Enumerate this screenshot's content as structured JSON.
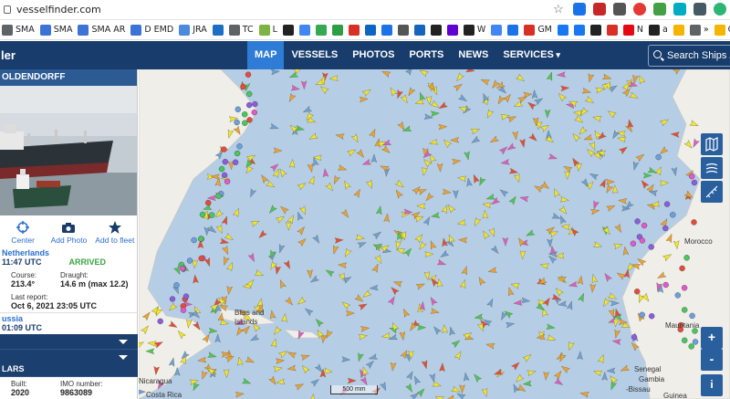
{
  "browser": {
    "url": "vesselfinder.com",
    "bookmarks": [
      {
        "label": "SMA",
        "icon": "globe-icon",
        "color": "#5f6368"
      },
      {
        "label": "SMA",
        "icon": "bookmark-site-icon",
        "color": "#3b73d6"
      },
      {
        "label": "SMA AR",
        "icon": "bookmark-site-icon",
        "color": "#3b73d6"
      },
      {
        "label": "D EMD",
        "icon": "bookmark-site-icon",
        "color": "#3b73d6"
      },
      {
        "label": "JRA",
        "icon": "diamond-icon",
        "color": "#4a8bdb"
      },
      {
        "label": "",
        "icon": "outlook-icon",
        "color": "#1d6fc4"
      },
      {
        "label": "TC",
        "icon": "globe-icon",
        "color": "#5f6368"
      },
      {
        "label": "L",
        "icon": "bookmark-site-icon",
        "color": "#7cb342"
      },
      {
        "label": "",
        "icon": "bookmark-site-icon",
        "color": "#222222"
      },
      {
        "label": "",
        "icon": "google-icon",
        "color": "#4285f4"
      },
      {
        "label": "",
        "icon": "maps-icon",
        "color": "#34a853"
      },
      {
        "label": "",
        "icon": "bookmark-site-icon",
        "color": "#2e9e44"
      },
      {
        "label": "",
        "icon": "bookmark-site-icon",
        "color": "#d93025"
      },
      {
        "label": "",
        "icon": "linkedin-icon",
        "color": "#0a66c2"
      },
      {
        "label": "",
        "icon": "bookmark-site-icon",
        "color": "#1a73e8"
      },
      {
        "label": "",
        "icon": "bookmark-site-icon",
        "color": "#555555"
      },
      {
        "label": "",
        "icon": "bookmark-site-icon",
        "color": "#1565c0"
      },
      {
        "label": "",
        "icon": "bookmark-site-icon",
        "color": "#222222"
      },
      {
        "label": "",
        "icon": "yahoo-icon",
        "color": "#6001d2"
      },
      {
        "label": "W",
        "icon": "wikipedia-icon",
        "color": "#222222"
      },
      {
        "label": "",
        "icon": "bookmark-site-icon",
        "color": "#4285f4"
      },
      {
        "label": "",
        "icon": "bookmark-site-icon",
        "color": "#1a73e8"
      },
      {
        "label": "GM",
        "icon": "bookmark-site-icon",
        "color": "#d93025"
      },
      {
        "label": "",
        "icon": "facebook-icon",
        "color": "#1877f2"
      },
      {
        "label": "",
        "icon": "facebook-icon",
        "color": "#1877f2"
      },
      {
        "label": "",
        "icon": "bookmark-site-icon",
        "color": "#222222"
      },
      {
        "label": "",
        "icon": "bookmark-site-icon",
        "color": "#d93025"
      },
      {
        "label": "N",
        "icon": "netflix-icon",
        "color": "#e50914"
      },
      {
        "label": "a",
        "icon": "amazon-icon",
        "color": "#222222"
      },
      {
        "label": "",
        "icon": "bookmark-site-icon",
        "color": "#f4b400"
      },
      {
        "label": "»",
        "icon": "overflow-icon",
        "color": "#5f6368"
      },
      {
        "label": "Oth",
        "icon": "folder-icon",
        "color": "#f4b400"
      }
    ]
  },
  "site": {
    "brand": "ler",
    "menu": [
      "MAP",
      "VESSELS",
      "PHOTOS",
      "PORTS",
      "NEWS",
      "SERVICES"
    ],
    "active_menu": "MAP",
    "search_placeholder": "Search Ships / P"
  },
  "vessel": {
    "name": "OLDENDORFF",
    "actions": [
      {
        "label": "Center",
        "icon": "crosshair-icon"
      },
      {
        "label": "Add Photo",
        "icon": "camera-icon"
      },
      {
        "label": "Add to fleet",
        "icon": "star-icon"
      }
    ],
    "destination": "Netherlands",
    "eta": "11:47 UTC",
    "status": "ARRIVED",
    "course_label": "Course:",
    "course_value": "213.4°",
    "draught_label": "Draught:",
    "draught_value": "14.6 m (max 12.2)",
    "report_label": "Last report:",
    "report_value": "Oct 6, 2021 23:05 UTC",
    "departure": "ussia",
    "departure_time": "01:09 UTC",
    "section_particulars": "LARS",
    "built_label": "Built:",
    "built_value": "2020",
    "imo_label": "IMO number:",
    "imo_value": "9863089"
  },
  "map": {
    "labels": [
      "Morocco",
      "Mauritania",
      "Senegal",
      "Gambia",
      "Guinea",
      "-Bissau",
      "Nicaragua",
      "Costa Rica",
      "Islands",
      "Bliss and"
    ],
    "scale": "500 mm",
    "controls": [
      "map-layers-icon",
      "weather-icon",
      "measure-icon",
      "+",
      "-",
      "i"
    ]
  }
}
